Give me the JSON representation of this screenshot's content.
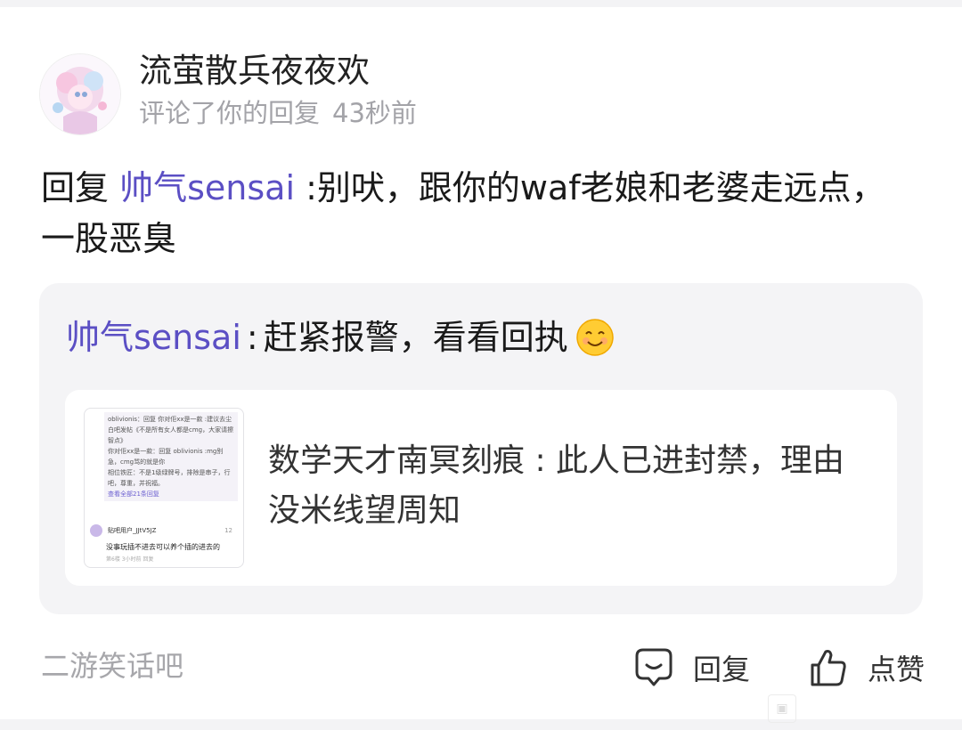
{
  "notification": {
    "username": "流萤散兵夜夜欢",
    "action": "评论了你的回复",
    "time": "43秒前",
    "comment": {
      "prefix": "回复",
      "mention": "帅气sensai",
      "body": ":别吠，跟你的waf老娘和老婆走远点，一股恶臭"
    },
    "quoted": {
      "author": "帅气sensai",
      "separator": ":",
      "text": "赶紧报警，看看回执",
      "emoji_icon": "smiley-emoji-icon",
      "shared_post": {
        "thumbnail": {
          "line1": "oblivionis：回复 你对佢xx是一款 :建议去尘白吧发帖《不是所有女人都是cmg，大家请擦智点》",
          "line2": "你对佢xx是一款：回复 oblivionis :mg别急，cmg骂的就是你",
          "line3": "相位铁匠：不是1级绿牌号，排除是串子，行吧，尊重，并祝福。",
          "see_all": "查看全部21条回复",
          "user": "贴吧用户_JJtV5JZ",
          "likes": "12",
          "comment": "没事玩插不进去可以养个插的进去的",
          "meta": "第6楼 3小时前 回复"
        },
        "text": "数学天才南冥刻痕 : 此人已进封禁，理由没米线望周知"
      }
    },
    "source": "二游笑话吧",
    "actions": {
      "reply_label": "回复",
      "reply_icon": "comment-bubble-icon",
      "like_label": "点赞",
      "like_icon": "thumbs-up-icon"
    },
    "colors": {
      "mention": "#5b4fc4",
      "quote_background": "#f4f4f6",
      "muted_text": "#a3a3a8"
    }
  }
}
